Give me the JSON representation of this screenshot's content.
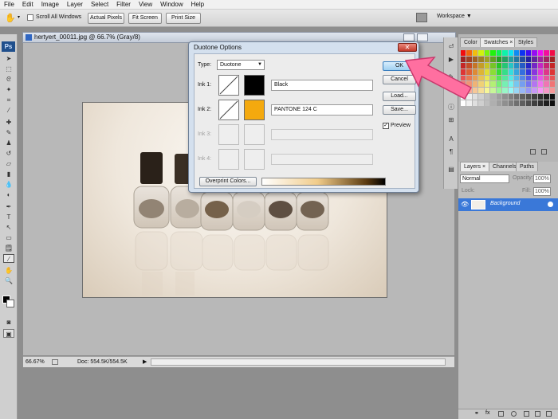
{
  "menu": [
    "File",
    "Edit",
    "Image",
    "Layer",
    "Select",
    "Filter",
    "View",
    "Window",
    "Help"
  ],
  "options_bar": {
    "scroll_all_windows": "Scroll All Windows",
    "actual_pixels": "Actual Pixels",
    "fit_screen": "Fit Screen",
    "print_size": "Print Size",
    "workspace": "Workspace ▼"
  },
  "document": {
    "title": "hertyert_00011.jpg @ 66.7% (Gray/8)",
    "zoom": "66.67%",
    "doc_size": "Doc: 554.5K/554.5K"
  },
  "panels": {
    "swatch_tabs": [
      "Color",
      "Swatches ×",
      "Styles"
    ],
    "layer_tabs": [
      "Layers ×",
      "Channels",
      "Paths"
    ],
    "blend_mode": "Normal",
    "opacity_label": "Opacity:",
    "opacity_value": "100%",
    "lock_label": "Lock:",
    "fill_label": "Fill:",
    "fill_value": "100%",
    "layer_name": "Background"
  },
  "dialog": {
    "title": "Duotone Options",
    "type_label": "Type:",
    "type_value": "Duotone",
    "ink1_label": "Ink 1:",
    "ink1_name": "Black",
    "ink1_color": "#000000",
    "ink2_label": "Ink 2:",
    "ink2_name": "PANTONE 124 C",
    "ink2_color": "#f4a90e",
    "ink3_label": "Ink 3:",
    "ink4_label": "Ink 4:",
    "overprint": "Overprint Colors...",
    "ok": "OK",
    "cancel": "Cancel",
    "load": "Load...",
    "save": "Save...",
    "preview": "Preview"
  },
  "colors": {
    "accent_arrow": "#ff6fa0",
    "layer_selected": "#3a78d8"
  }
}
